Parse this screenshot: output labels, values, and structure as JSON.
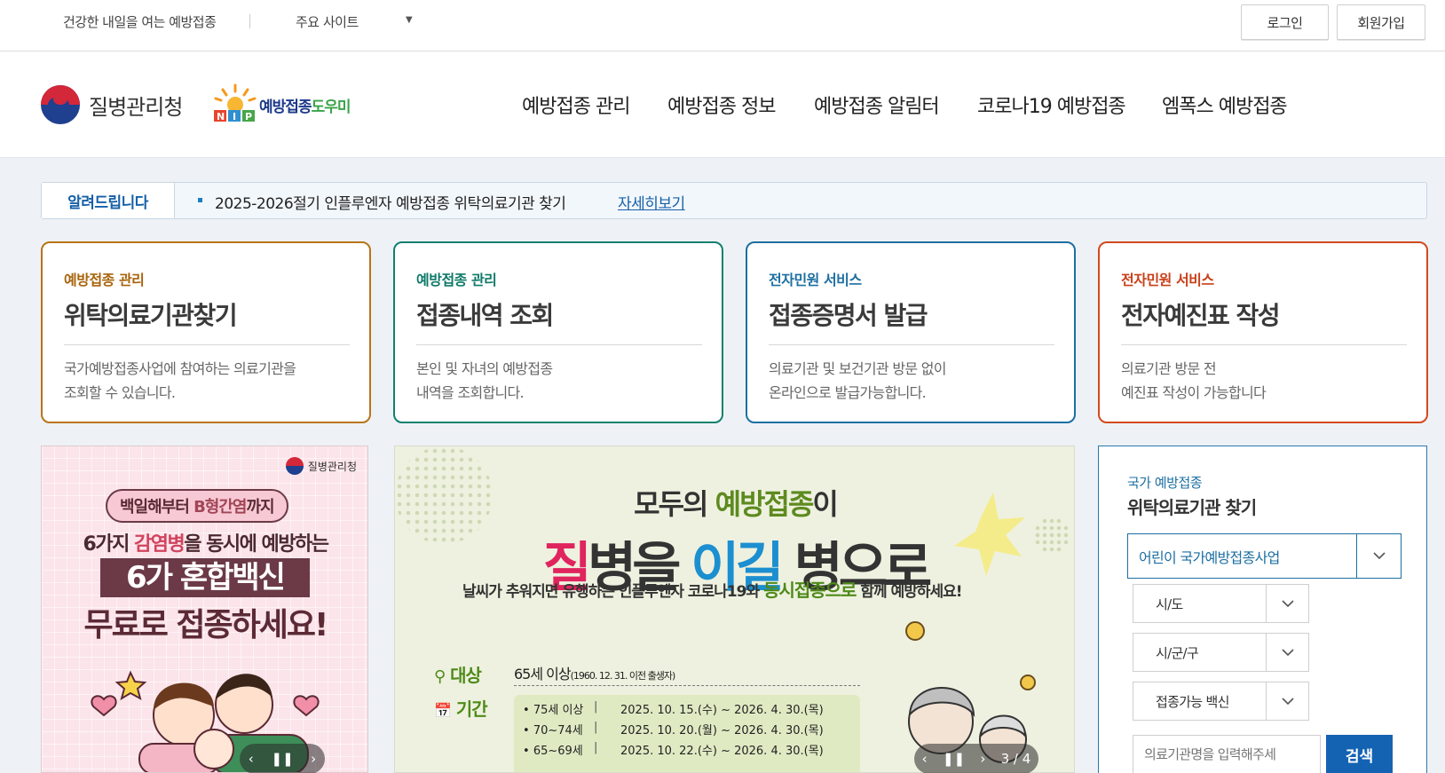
{
  "top": {
    "tagline": "건강한 내일을 여는 예방접종",
    "sites_label": "주요 사이트",
    "login_label": "로그인",
    "join_label": "회원가입"
  },
  "header": {
    "kdca_name": "질병관리청",
    "nip_name_a": "예방접종",
    "nip_name_b": "도우미",
    "nav": [
      "예방접종 관리",
      "예방접종 정보",
      "예방접종 알림터",
      "코로나19 예방접종",
      "엠폭스 예방접종"
    ]
  },
  "notice": {
    "label": "알려드립니다",
    "text": "2025-2026절기 인플루엔자 예방접종 위탁의료기관 찾기",
    "more": "자세히보기"
  },
  "cards": [
    {
      "category": "예방접종 관리",
      "title": "위탁의료기관찾기",
      "desc1": "국가예방접종사업에 참여하는 의료기관을",
      "desc2": "조회할 수 있습니다."
    },
    {
      "category": "예방접종 관리",
      "title": "접종내역 조회",
      "desc1": "본인 및 자녀의 예방접종",
      "desc2": "내역을 조회합니다."
    },
    {
      "category": "전자민원 서비스",
      "title": "접종증명서 발급",
      "desc1": "의료기관 및 보건기관 방문 없이",
      "desc2": "온라인으로 발급가능합니다."
    },
    {
      "category": "전자민원 서비스",
      "title": "전자예진표 작성",
      "desc1": "의료기관 방문 전",
      "desc2": "예진표 작성이 가능합니다"
    }
  ],
  "banner1": {
    "corp": "질병관리청",
    "pill_a": "백일해부터 ",
    "pill_b": "B형간염",
    "pill_c": "까지",
    "line2_a": "6가지 ",
    "line2_b": "감염병",
    "line2_c": "을 동시에 예방하는",
    "box": "6가 혼합백신",
    "line4": "무료로 접종하세요!"
  },
  "banner2": {
    "h1_a": "모두의 ",
    "h1_b": "예방접종",
    "h1_c": "이",
    "h2_a": "질",
    "h2_b": "병을 ",
    "h2_c": "이길",
    "h2_d": " 병으로",
    "h3_a": "날씨가 추워지면 유행하는 인플루엔자 코로나19와 ",
    "h3_b": "동시접종으로",
    "h3_c": " 함께 예방하세요!",
    "target_key": "대상",
    "target_val": "65세 이상",
    "target_note": "(1960. 12. 31. 이전 출생자)",
    "period_key": "기간",
    "schedule": [
      {
        "age": "75세 이상",
        "dates": "2025. 10. 15.(수) ~ 2026. 4. 30.(목)"
      },
      {
        "age": "70~74세",
        "dates": "2025. 10. 20.(월) ~ 2026. 4. 30.(목)"
      },
      {
        "age": "65~69세",
        "dates": "2025. 10. 22.(수) ~ 2026. 4. 30.(목)"
      }
    ],
    "page": "3 / 4"
  },
  "search": {
    "category": "국가 예방접종",
    "title": "위탁의료기관 찾기",
    "program": "어린이 국가예방접종사업",
    "sido": "시/도",
    "sigungu": "시/군/구",
    "vaccine": "접종가능 백신",
    "placeholder": "의료기관명을 입력해주세",
    "button": "검색"
  }
}
